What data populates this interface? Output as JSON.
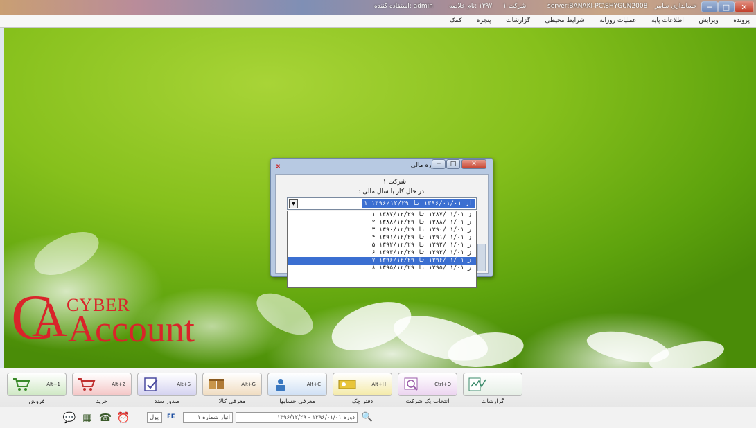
{
  "titlebar": {
    "user": "admin :استفاده کننده",
    "fiscal_year": "۱۳۹۷ :نام خلاصه",
    "company": "شرکت ۱",
    "server": "server:BANAKI-PC\\SHYGUN2008",
    "app_name": "حسابداری سایبر",
    "btn_min": "─",
    "btn_max": "□",
    "btn_close": "✕"
  },
  "menu": [
    "پرونده",
    "ویرایش",
    "اطلاعات پایه",
    "عملیات روزانه",
    "شرایط محیطی",
    "گزارشات",
    "پنجره",
    "کمک"
  ],
  "logo": {
    "c": "C",
    "a": "A",
    "word1": "CYBER",
    "word2": "Account"
  },
  "dialog": {
    "title": "تغییر دوره مالی",
    "company_label": "شرکت ۱",
    "prompt": "در حال کار با سال مالی :",
    "btn_min": "─",
    "btn_max": "□",
    "btn_close": "✕",
    "selected_value": "۱ از ۱۳۹۶/۰۱/۰۱ تا ۱۳۹۶/۱۲/۲۹",
    "options": [
      "۱ از ۱۳۸۷/۰۱/۰۱ تا ۱۳۸۷/۱۲/۲۹",
      "۲ از ۱۳۸۸/۰۱/۰۱ تا ۱۳۸۸/۱۲/۲۹",
      "۳ از ۱۳۹۰/۰۱/۰۱ تا ۱۳۹۰/۱۲/۲۹",
      "۴ از ۱۳۹۱/۰۱/۰۱ تا ۱۳۹۱/۱۲/۲۹",
      "۵ از ۱۳۹۲/۰۱/۰۱ تا ۱۳۹۲/۱۲/۲۹",
      "۶ از ۱۳۹۳/۰۱/۰۱ تا ۱۳۹۳/۱۲/۲۹",
      "۷ از ۱۳۹۶/۰۱/۰۱ تا ۱۳۹۶/۱۲/۲۹",
      "۸ از ۱۳۹۵/۰۱/۰۱ تا ۱۳۹۵/۱۲/۲۹"
    ],
    "selected_index": 6
  },
  "toolbar": [
    {
      "label": "فروش",
      "shortcut": "Alt+1",
      "color": "#cfe8c4",
      "icon": "cart-icon"
    },
    {
      "label": "خرید",
      "shortcut": "Alt+2",
      "color": "#f4c6c6",
      "icon": "cart-buy-icon"
    },
    {
      "label": "صدور سند",
      "shortcut": "Alt+S",
      "color": "#d4d2f0",
      "icon": "document-check-icon"
    },
    {
      "label": "معرفی کالا",
      "shortcut": "Alt+G",
      "color": "#f0dcc0",
      "icon": "goods-icon"
    },
    {
      "label": "معرفی حسابها",
      "shortcut": "Alt+C",
      "color": "#cfe0f4",
      "icon": "accounts-icon"
    },
    {
      "label": "دفتر چک",
      "shortcut": "Alt+H",
      "color": "#f4eaa8",
      "icon": "checkbook-icon"
    },
    {
      "label": "انتخاب یک شرکت",
      "shortcut": "Ctrl+O",
      "color": "#ecd4f0",
      "icon": "company-select-icon"
    },
    {
      "label": "گزارشات",
      "shortcut": "",
      "color": "#e6efe6",
      "icon": "reports-icon"
    }
  ],
  "statusbar": {
    "period": "دوره ۱۳۹۶/۰۱/۰۱ - ۱۳۹۶/۱۲/۲۹",
    "warehouse": "انبار شماره ۱",
    "lang": "FE",
    "numeric": "پول"
  }
}
